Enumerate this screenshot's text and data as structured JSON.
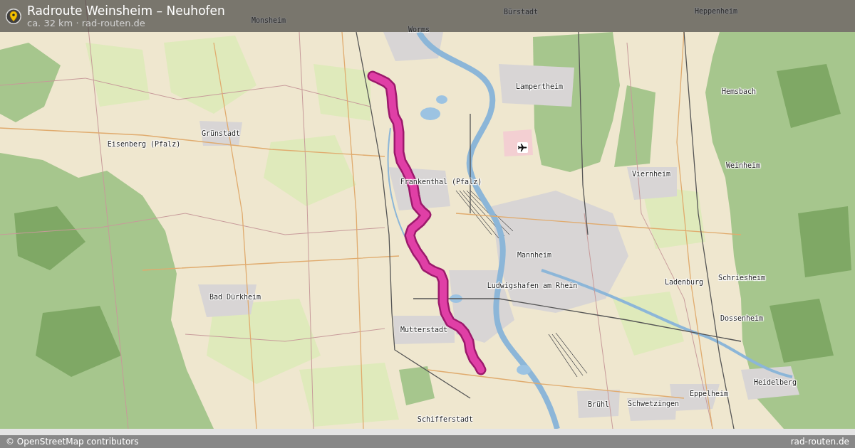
{
  "header": {
    "title": "Radroute Weinsheim – Neuhofen",
    "subtitle": "ca. 32 km · rad-routen.de"
  },
  "map": {
    "labels": [
      {
        "text": "Heppenheim"
      },
      {
        "text": "Bürstadt"
      },
      {
        "text": "Monsheim"
      },
      {
        "text": "Worms"
      },
      {
        "text": "Lampertheim"
      },
      {
        "text": "Hemsbach"
      },
      {
        "text": "Grünstadt"
      },
      {
        "text": "Eisenberg (Pfalz)"
      },
      {
        "text": "Weinheim"
      },
      {
        "text": "Viernheim"
      },
      {
        "text": "Frankenthal (Pfalz)"
      },
      {
        "text": "Mannheim"
      },
      {
        "text": "Schriesheim"
      },
      {
        "text": "Ladenburg"
      },
      {
        "text": "Ludwigshafen am Rhein"
      },
      {
        "text": "Bad Dürkheim"
      },
      {
        "text": "Dossenheim"
      },
      {
        "text": "Mutterstadt"
      },
      {
        "text": "Heidelberg"
      },
      {
        "text": "Eppelheim"
      },
      {
        "text": "Brühl"
      },
      {
        "text": "Schwetzingen"
      },
      {
        "text": "Schifferstadt"
      }
    ]
  },
  "footer": {
    "attribution": "© OpenStreetMap contributors",
    "site": "rad-routen.de"
  }
}
